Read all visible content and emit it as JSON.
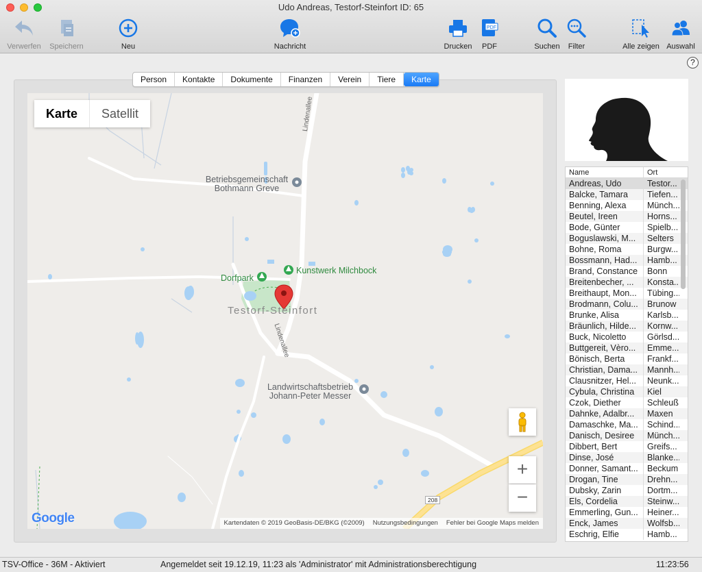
{
  "window": {
    "title": "Udo Andreas, Testorf-Steinfort ID: 65"
  },
  "toolbar": {
    "discard_label": "Verwerfen",
    "save_label": "Speichern",
    "new_label": "Neu",
    "message_label": "Nachricht",
    "print_label": "Drucken",
    "pdf_label": "PDF",
    "search_label": "Suchen",
    "filter_label": "Filter",
    "show_all_label": "Alle zeigen",
    "selection_label": "Auswahl"
  },
  "help": "?",
  "tabs": [
    {
      "label": "Person"
    },
    {
      "label": "Kontakte"
    },
    {
      "label": "Dokumente"
    },
    {
      "label": "Finanzen"
    },
    {
      "label": "Verein"
    },
    {
      "label": "Tiere"
    },
    {
      "label": "Karte",
      "active": true
    }
  ],
  "map": {
    "type_map": "Karte",
    "type_satellite": "Satellit",
    "poi_betrieb_1": "Betriebsgemeinschaft",
    "poi_betrieb_2": "Bothmann Greve",
    "poi_kunstwerk": "Kunstwerk Milchbock",
    "poi_dorfpark": "Dorfpark",
    "place": "Testorf-Steinfort",
    "road_lindenallee": "Lindenallee",
    "poi_landwirt_1": "Landwirtschaftsbetrieb",
    "poi_landwirt_2": "Johann-Peter Messer",
    "road_208": "208",
    "google_logo": "Google",
    "attribution": "Kartendaten © 2019 GeoBasis-DE/BKG (©2009)",
    "terms": "Nutzungsbedingungen",
    "report": "Fehler bei Google Maps melden",
    "zoom_in": "+",
    "zoom_out": "−"
  },
  "list": {
    "col_name": "Name",
    "col_ort": "Ort",
    "rows": [
      {
        "name": "Andreas, Udo",
        "ort": "Testor...",
        "selected": true
      },
      {
        "name": "Balcke, Tamara",
        "ort": "Tiefen..."
      },
      {
        "name": "Benning, Alexa",
        "ort": "Münch..."
      },
      {
        "name": "Beutel, Ireen",
        "ort": "Horns..."
      },
      {
        "name": "Bode, Günter",
        "ort": "Spielb..."
      },
      {
        "name": "Boguslawski, M...",
        "ort": "Selters"
      },
      {
        "name": "Bohne, Roma",
        "ort": "Burgw..."
      },
      {
        "name": "Bossmann, Had...",
        "ort": "Hamb..."
      },
      {
        "name": "Brand, Constance",
        "ort": "Bonn"
      },
      {
        "name": "Breitenbecher, ...",
        "ort": "Konsta..."
      },
      {
        "name": "Breithaupt, Mon...",
        "ort": "Tübing..."
      },
      {
        "name": "Brodmann, Colu...",
        "ort": "Brunow"
      },
      {
        "name": "Brunke, Alisa",
        "ort": "Karlsb..."
      },
      {
        "name": "Bräunlich, Hilde...",
        "ort": "Kornw..."
      },
      {
        "name": "Buck, Nicoletto",
        "ort": "Görlsd..."
      },
      {
        "name": "Buttgereit, Vèro...",
        "ort": "Emme..."
      },
      {
        "name": "Bönisch, Berta",
        "ort": "Frankf..."
      },
      {
        "name": "Christian, Dama...",
        "ort": "Mannh..."
      },
      {
        "name": "Clausnitzer, Hel...",
        "ort": "Neunk..."
      },
      {
        "name": "Cybula, Christina",
        "ort": "Kiel"
      },
      {
        "name": "Czok, Diether",
        "ort": "Schleuß"
      },
      {
        "name": "Dahnke, Adalbr...",
        "ort": "Maxen"
      },
      {
        "name": "Damaschke, Ma...",
        "ort": "Schind..."
      },
      {
        "name": "Danisch, Desiree",
        "ort": "Münch..."
      },
      {
        "name": "Dibbert, Bert",
        "ort": "Greifs..."
      },
      {
        "name": "Dinse, José",
        "ort": "Blanke..."
      },
      {
        "name": "Donner, Samant...",
        "ort": "Beckum"
      },
      {
        "name": "Drogan, Tine",
        "ort": "Drehn..."
      },
      {
        "name": "Dubsky, Zarin",
        "ort": "Dortm..."
      },
      {
        "name": "Els, Cordelia",
        "ort": "Steinw..."
      },
      {
        "name": "Emmerling, Gun...",
        "ort": "Heiner..."
      },
      {
        "name": "Enck, James",
        "ort": "Wolfsb..."
      },
      {
        "name": "Eschrig, Elfie",
        "ort": "Hamb..."
      }
    ]
  },
  "status": {
    "app": "TSV-Office - 36M - Aktiviert",
    "login": "Angemeldet seit 19.12.19, 11:23 als 'Administrator' mit Administrationsberechtigung",
    "time": "11:23:56"
  },
  "colors": {
    "accent": "#1a7bf5",
    "toolbar_icon": "#1877e6",
    "pin": "#e53935",
    "park": "#2f8a3f"
  }
}
